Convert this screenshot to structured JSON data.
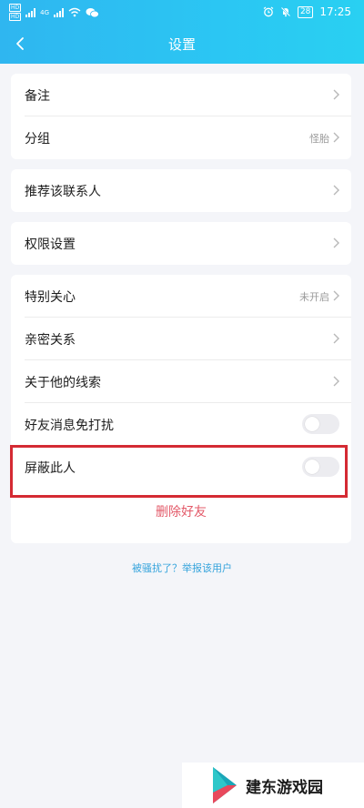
{
  "status_bar": {
    "hd_top": "HD",
    "hd_bottom": "HD",
    "network": "4G",
    "battery": "28",
    "time": "17:25"
  },
  "nav": {
    "title": "设置",
    "back_icon": "chevron-left-icon"
  },
  "groups": {
    "basic": [
      {
        "label": "备注",
        "value": ""
      },
      {
        "label": "分组",
        "value": "怪胎"
      }
    ],
    "recommend": {
      "label": "推荐该联系人"
    },
    "permissions": {
      "label": "权限设置"
    },
    "friend": {
      "special_care": {
        "label": "特别关心",
        "value": "未开启"
      },
      "intimate": {
        "label": "亲密关系"
      },
      "clues": {
        "label": "关于他的线索"
      },
      "mute": {
        "label": "好友消息免打扰",
        "enabled": false
      },
      "block": {
        "label": "屏蔽此人",
        "enabled": false
      }
    }
  },
  "delete_label": "删除好友",
  "report_link": "被骚扰了？举报该用户",
  "watermark": {
    "text": "建东游戏园"
  },
  "colors": {
    "header": "#2bc6f3",
    "delete": "#e35a69",
    "link": "#36a4dc",
    "highlight": "#d42a33"
  }
}
